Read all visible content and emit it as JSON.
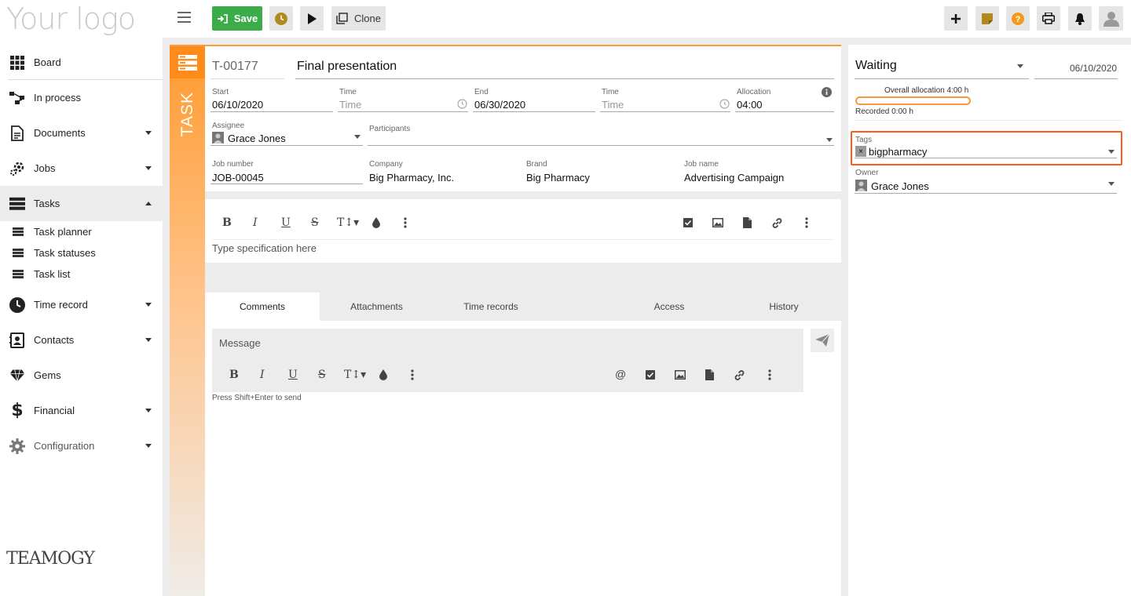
{
  "app": {
    "logo_text": "Your logo",
    "brand": "TEAMOGY"
  },
  "colors": {
    "accent": "#ff9a3c",
    "save": "#3cab4a",
    "highlight": "#ff5a1f",
    "timer": "#b08a1c"
  },
  "sidebar": {
    "items": [
      {
        "label": "Board",
        "icon": "grid-icon"
      },
      {
        "label": "In process",
        "icon": "workflow-icon"
      },
      {
        "label": "Documents",
        "icon": "document-icon"
      },
      {
        "label": "Jobs",
        "icon": "jobs-icon"
      },
      {
        "label": "Tasks",
        "icon": "tasks-icon"
      },
      {
        "label": "Time record",
        "icon": "clock-icon"
      },
      {
        "label": "Contacts",
        "icon": "contacts-icon"
      },
      {
        "label": "Gems",
        "icon": "gem-icon"
      },
      {
        "label": "Financial",
        "icon": "dollar-icon"
      },
      {
        "label": "Configuration",
        "icon": "gear-icon"
      }
    ],
    "subitems": [
      {
        "label": "Task planner"
      },
      {
        "label": "Task statuses"
      },
      {
        "label": "Task list"
      }
    ]
  },
  "toolbar": {
    "save_label": "Save",
    "clone_label": "Clone"
  },
  "task": {
    "strip_label": "TASK",
    "id": "T-00177",
    "title": "Final presentation",
    "start_label": "Start",
    "start_value": "06/10/2020",
    "time_label": "Time",
    "time_placeholder": "Time",
    "end_label": "End",
    "end_value": "06/30/2020",
    "allocation_label": "Allocation",
    "allocation_value": "04:00",
    "assignee_label": "Assignee",
    "assignee_value": "Grace Jones",
    "participants_label": "Participants",
    "job_number_label": "Job number",
    "job_number_value": "JOB-00045",
    "company_label": "Company",
    "company_value": "Big Pharmacy, Inc.",
    "brand_label": "Brand",
    "brand_value": "Big Pharmacy",
    "job_name_label": "Job name",
    "job_name_value": "Advertising Campaign",
    "spec_placeholder": "Type specification here"
  },
  "tabs": [
    "Comments",
    "Attachments",
    "Time records",
    "Access",
    "History"
  ],
  "comment": {
    "placeholder": "Message",
    "hint": "Press Shift+Enter to send"
  },
  "side": {
    "status": "Waiting",
    "date": "06/10/2020",
    "overall_allocation": "Overall allocation 4:00 h",
    "recorded": "Recorded 0:00 h",
    "recorded_fraction": 0,
    "tags_label": "Tags",
    "tag": "bigpharmacy",
    "owner_label": "Owner",
    "owner_value": "Grace Jones"
  }
}
